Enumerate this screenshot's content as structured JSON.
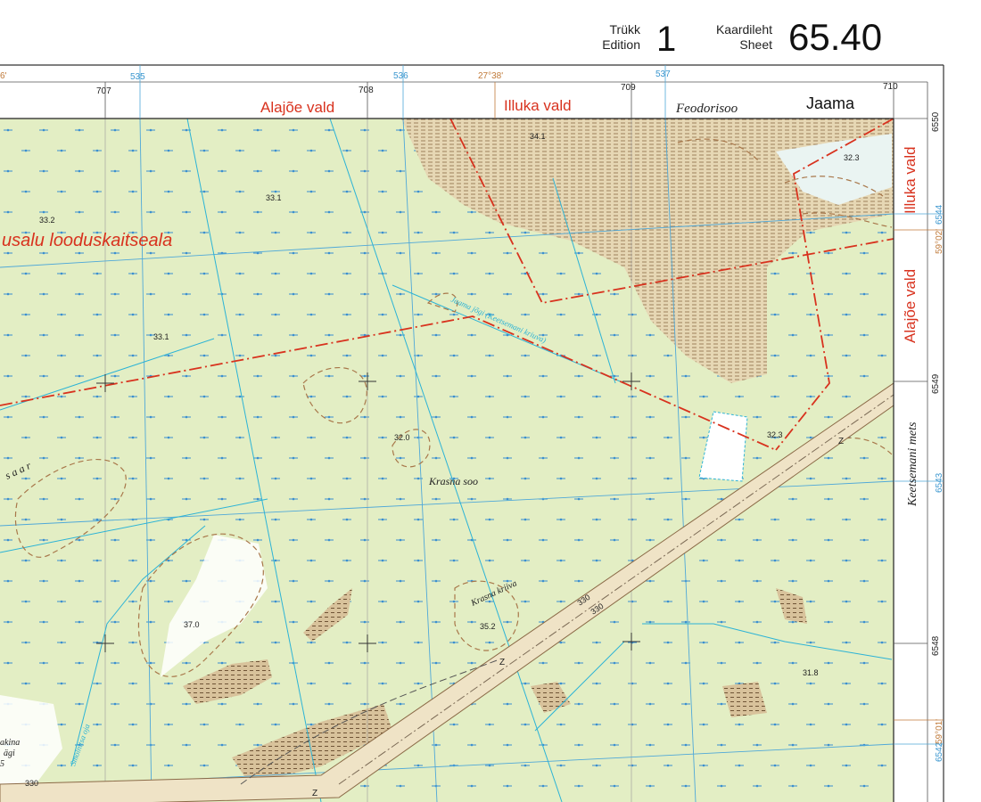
{
  "header": {
    "edition_label_et": "Trükk",
    "edition_label_en": "Edition",
    "edition_number": "1",
    "sheet_label_et": "Kaardileht",
    "sheet_label_en": "Sheet",
    "sheet_number": "65.40"
  },
  "frame": {
    "top_grid_km": [
      "707",
      "708",
      "709",
      "710"
    ],
    "top_blue_grid": [
      "535",
      "536",
      "537"
    ],
    "top_longitude": "27°38'",
    "top_longitude_partial": "6'",
    "right_grid_km": [
      "6550",
      "6549",
      "6548"
    ],
    "right_blue_grid": [
      "6544",
      "6543",
      "6542"
    ],
    "right_latitudes": [
      "59°02'",
      "59°01'"
    ],
    "top_labels": {
      "alajoe": "Alajõe vald",
      "illuka": "Illuka vald",
      "feodorisoo": "Feodorisoo",
      "jaama": "Jaama"
    },
    "right_labels": {
      "illuka": "Illuka vald",
      "alajoe": "Alajõe vald",
      "keetsemani": "Keetsemani mets"
    }
  },
  "map": {
    "reserve_name": "usalu looduskaitseala",
    "marsh_name": "Krasna soo",
    "ditch_krasna": "Krasna kriiva",
    "river_name": "Jaama jõgi (Keetsemani kriuva)",
    "saar": "s a a r",
    "smolnitsa": "Smolnitsa oja",
    "left_edge_text_1": "akina",
    "left_edge_text_2": "ägi",
    "left_edge_text_3": "5",
    "pipeline_label": "330",
    "zone_letter": "Z",
    "elevations": [
      {
        "id": "e1",
        "label": "34.1"
      },
      {
        "id": "e2",
        "label": "33.1"
      },
      {
        "id": "e3",
        "label": "33.2"
      },
      {
        "id": "e4",
        "label": "33.1"
      },
      {
        "id": "e5",
        "label": "32.0"
      },
      {
        "id": "e6",
        "label": "32.3"
      },
      {
        "id": "e7",
        "label": "32.3"
      },
      {
        "id": "e8",
        "label": "37.0"
      },
      {
        "id": "e9",
        "label": "35.2"
      },
      {
        "id": "e10",
        "label": "31.8"
      },
      {
        "id": "e11",
        "label": "330"
      }
    ]
  },
  "colors": {
    "marsh_green": "#e3eec4",
    "forest_green": "#cfe4b6",
    "sand": "#f0e3c8",
    "boundary_red": "#d8321e",
    "water_blue": "#2cb3d6",
    "grid_blue": "#4fa8d8",
    "contour_brown": "#a8774a"
  }
}
